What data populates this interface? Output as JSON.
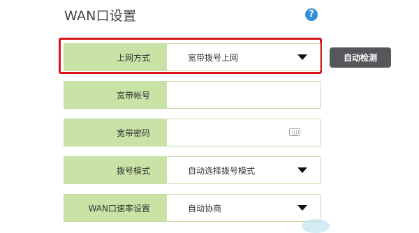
{
  "page": {
    "title": "WAN口设置",
    "help_icon": "?"
  },
  "form": {
    "rows": [
      {
        "label": "上网方式",
        "value": "宽带拨号上网",
        "control": "select"
      },
      {
        "label": "宽带帐号",
        "value": "",
        "control": "text"
      },
      {
        "label": "宽带密码",
        "value": "",
        "control": "password",
        "icon": "keyboard-icon"
      },
      {
        "label": "拨号模式",
        "value": "自动选择拨号模式",
        "control": "select"
      },
      {
        "label": "WAN口速率设置",
        "value": "自动协商",
        "control": "select"
      }
    ]
  },
  "buttons": {
    "auto_detect": "自动检测"
  },
  "colors": {
    "label_bg": "#c9e3a7",
    "row_border": "#c6dba8",
    "highlight": "#d9141a",
    "button_bg": "#55575a",
    "help_icon": "#2f8fd8"
  }
}
